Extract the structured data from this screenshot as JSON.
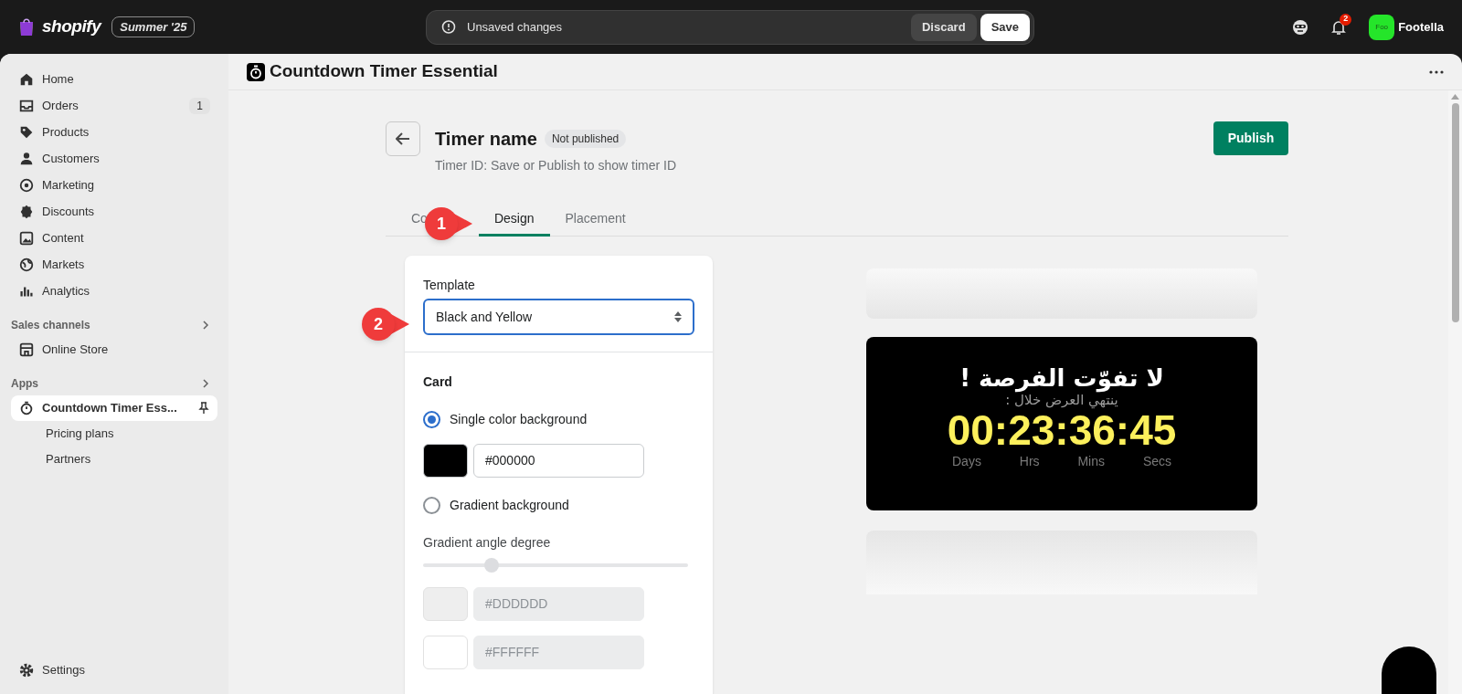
{
  "top_bar": {
    "logo": "shopify",
    "edition_badge": "Summer '25",
    "save_bar": {
      "message": "Unsaved changes",
      "buttons": [
        {
          "label": "Discard",
          "kind": "secondary"
        },
        {
          "label": "Save",
          "kind": "primary"
        }
      ]
    },
    "notification_count": "2",
    "account": {
      "initials": "Foo",
      "name": "Footella"
    }
  },
  "sidebar": {
    "items": [
      {
        "label": "Home",
        "selected": false
      },
      {
        "label": "Orders",
        "badge": "1",
        "selected": false
      },
      {
        "label": "Products",
        "selected": false
      },
      {
        "label": "Customers",
        "selected": false
      },
      {
        "label": "Marketing",
        "selected": false
      },
      {
        "label": "Discounts",
        "selected": false
      },
      {
        "label": "Content",
        "selected": false
      },
      {
        "label": "Markets",
        "selected": false
      },
      {
        "label": "Analytics",
        "selected": false
      }
    ],
    "sections": [
      {
        "title": "Sales channels",
        "items": [
          {
            "label": "Online Store",
            "selected": false
          }
        ]
      },
      {
        "title": "Apps",
        "items": [
          {
            "label": "Countdown Timer Ess...",
            "selected": true,
            "pinned": true,
            "children": [
              {
                "label": "Pricing plans",
                "selected": false
              },
              {
                "label": "Partners",
                "selected": false
              }
            ]
          }
        ]
      }
    ],
    "footer": {
      "label": "Settings"
    }
  },
  "app_header": {
    "title": "Countdown Timer Essential"
  },
  "page": {
    "title": "Timer name",
    "status_badge": "Not published",
    "subtitle": "Timer ID: Save or Publish to show timer ID",
    "primary_action": "Publish",
    "tabs": [
      {
        "label": "Co",
        "selected": false
      },
      {
        "label": "Design",
        "selected": true
      },
      {
        "label": "Placement",
        "selected": false
      }
    ],
    "design_card": {
      "template": {
        "label": "Template",
        "value": "Black and Yellow"
      },
      "card_section": {
        "title": "Card",
        "options": [
          {
            "label": "Single color background",
            "selected": true
          }
        ],
        "single_colors": [
          {
            "value": "#000000",
            "color": "#000000",
            "disabled": false
          }
        ],
        "gradient_option": {
          "label": "Gradient background",
          "selected": false
        },
        "gradient_angle": {
          "label": "Gradient angle degree",
          "level": 0.26
        },
        "gradient_colors": [
          {
            "value": "#DDDDDD",
            "color": "#eeeeee",
            "disabled": true
          },
          {
            "value": "#FFFFFF",
            "color": "#ffffff",
            "disabled": true
          }
        ]
      }
    },
    "preview": {
      "headline": "لا تفوّت الفرصة !",
      "subheadline": "ينتهي العرض خلال :",
      "countdown": "00:23:36:45",
      "units": [
        "Days",
        "Hrs",
        "Mins",
        "Secs"
      ]
    }
  },
  "annotations": [
    {
      "number": "1"
    },
    {
      "number": "2"
    }
  ]
}
